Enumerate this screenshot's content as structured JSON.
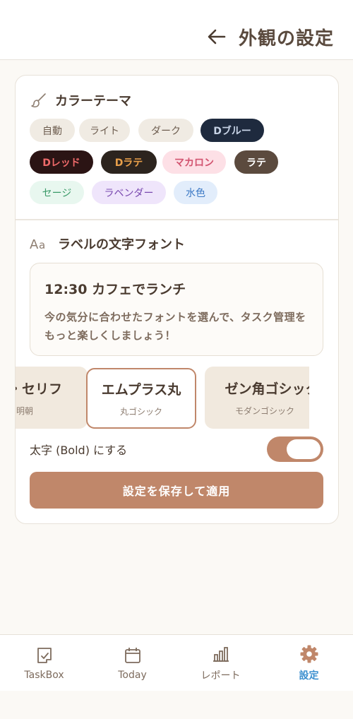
{
  "header": {
    "title": "外観の設定"
  },
  "theme_section": {
    "title": "カラーテーマ",
    "chips": [
      {
        "label": "自動",
        "bg": "#f0ebe3",
        "fg": "#6e5e50"
      },
      {
        "label": "ライト",
        "bg": "#f0ebe3",
        "fg": "#6e5e50"
      },
      {
        "label": "ダーク",
        "bg": "#f0ebe3",
        "fg": "#6e5e50"
      },
      {
        "label": "Dブルー",
        "bg": "#1e2a3e",
        "fg": "#c7d3e6"
      },
      {
        "label": "Dレッド",
        "bg": "#2b1414",
        "fg": "#ef6a6a"
      },
      {
        "label": "Dラテ",
        "bg": "#2c241e",
        "fg": "#e9a04a"
      },
      {
        "label": "マカロン",
        "bg": "#fde0e6",
        "fg": "#d25470"
      },
      {
        "label": "ラテ",
        "bg": "#5b4a3e",
        "fg": "#ffffff"
      },
      {
        "label": "セージ",
        "bg": "#e8f7ef",
        "fg": "#3a9a68"
      },
      {
        "label": "ラベンダー",
        "bg": "#efe5fb",
        "fg": "#7a4ab0"
      },
      {
        "label": "水色",
        "bg": "#e2edfb",
        "fg": "#3c79c5"
      }
    ]
  },
  "font_section": {
    "title": "ラベルの文字フォント",
    "preview_title": "12:30 カフェでランチ",
    "preview_text": "今の気分に合わせたフォントを選んで、タスク管理をもっと楽しくしましょう！",
    "fonts": [
      {
        "name": "・セリフ",
        "sub": "明朝"
      },
      {
        "name": "エムプラス丸",
        "sub": "丸ゴシック"
      },
      {
        "name": "ゼン角ゴシック",
        "sub": "モダンゴシック"
      }
    ]
  },
  "bold_toggle": {
    "label": "太字 (Bold) にする",
    "on": true
  },
  "save_button": {
    "label": "設定を保存して適用"
  },
  "nav": {
    "items": [
      {
        "label": "TaskBox"
      },
      {
        "label": "Today"
      },
      {
        "label": "レポート"
      },
      {
        "label": "設定"
      }
    ]
  },
  "colors": {
    "accent": "#c0876a",
    "active_nav": "#3b8fcf",
    "text": "#4a3b30"
  }
}
